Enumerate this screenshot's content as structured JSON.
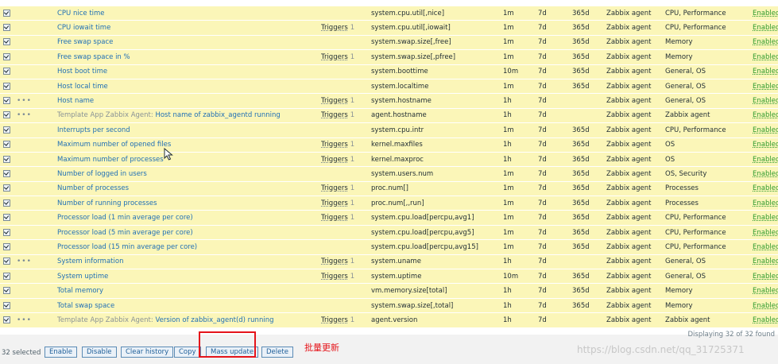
{
  "rows": [
    {
      "pre": "",
      "name": "CPU nice time",
      "triggers": "",
      "trig_count": "",
      "key": "system.cpu.util[,nice]",
      "interval": "1m",
      "history": "7d",
      "trends": "365d",
      "type": "Zabbix agent",
      "apps": "CPU, Performance",
      "status": "Enabled"
    },
    {
      "pre": "",
      "name": "CPU iowait time",
      "triggers": "Triggers",
      "trig_count": "1",
      "key": "system.cpu.util[,iowait]",
      "interval": "1m",
      "history": "7d",
      "trends": "365d",
      "type": "Zabbix agent",
      "apps": "CPU, Performance",
      "status": "Enabled"
    },
    {
      "pre": "",
      "name": "Free swap space",
      "triggers": "",
      "trig_count": "",
      "key": "system.swap.size[,free]",
      "interval": "1m",
      "history": "7d",
      "trends": "365d",
      "type": "Zabbix agent",
      "apps": "Memory",
      "status": "Enabled"
    },
    {
      "pre": "",
      "name": "Free swap space in %",
      "triggers": "Triggers",
      "trig_count": "1",
      "key": "system.swap.size[,pfree]",
      "interval": "1m",
      "history": "7d",
      "trends": "365d",
      "type": "Zabbix agent",
      "apps": "Memory",
      "status": "Enabled"
    },
    {
      "pre": "",
      "name": "Host boot time",
      "triggers": "",
      "trig_count": "",
      "key": "system.boottime",
      "interval": "10m",
      "history": "7d",
      "trends": "365d",
      "type": "Zabbix agent",
      "apps": "General, OS",
      "status": "Enabled"
    },
    {
      "pre": "",
      "name": "Host local time",
      "triggers": "",
      "trig_count": "",
      "key": "system.localtime",
      "interval": "1m",
      "history": "7d",
      "trends": "365d",
      "type": "Zabbix agent",
      "apps": "General, OS",
      "status": "Enabled"
    },
    {
      "pre": "",
      "name": "Host name",
      "triggers": "Triggers",
      "trig_count": "1",
      "key": "system.hostname",
      "interval": "1h",
      "history": "7d",
      "trends": "",
      "type": "Zabbix agent",
      "apps": "General, OS",
      "status": "Enabled",
      "dots": "•••"
    },
    {
      "pre": "Template App Zabbix Agent: ",
      "name": "Host name of zabbix_agentd running",
      "triggers": "Triggers",
      "trig_count": "1",
      "key": "agent.hostname",
      "interval": "1h",
      "history": "7d",
      "trends": "",
      "type": "Zabbix agent",
      "apps": "Zabbix agent",
      "status": "Enabled",
      "dots": "•••"
    },
    {
      "pre": "",
      "name": "Interrupts per second",
      "triggers": "",
      "trig_count": "",
      "key": "system.cpu.intr",
      "interval": "1m",
      "history": "7d",
      "trends": "365d",
      "type": "Zabbix agent",
      "apps": "CPU, Performance",
      "status": "Enabled"
    },
    {
      "pre": "",
      "name": "Maximum number of opened files",
      "triggers": "Triggers",
      "trig_count": "1",
      "key": "kernel.maxfiles",
      "interval": "1h",
      "history": "7d",
      "trends": "365d",
      "type": "Zabbix agent",
      "apps": "OS",
      "status": "Enabled"
    },
    {
      "pre": "",
      "name": "Maximum number of processes",
      "triggers": "Triggers",
      "trig_count": "1",
      "key": "kernel.maxproc",
      "interval": "1h",
      "history": "7d",
      "trends": "365d",
      "type": "Zabbix agent",
      "apps": "OS",
      "status": "Enabled"
    },
    {
      "pre": "",
      "name": "Number of logged in users",
      "triggers": "",
      "trig_count": "",
      "key": "system.users.num",
      "interval": "1m",
      "history": "7d",
      "trends": "365d",
      "type": "Zabbix agent",
      "apps": "OS, Security",
      "status": "Enabled"
    },
    {
      "pre": "",
      "name": "Number of processes",
      "triggers": "Triggers",
      "trig_count": "1",
      "key": "proc.num[]",
      "interval": "1m",
      "history": "7d",
      "trends": "365d",
      "type": "Zabbix agent",
      "apps": "Processes",
      "status": "Enabled"
    },
    {
      "pre": "",
      "name": "Number of running processes",
      "triggers": "Triggers",
      "trig_count": "1",
      "key": "proc.num[,,run]",
      "interval": "1m",
      "history": "7d",
      "trends": "365d",
      "type": "Zabbix agent",
      "apps": "Processes",
      "status": "Enabled"
    },
    {
      "pre": "",
      "name": "Processor load (1 min average per core)",
      "triggers": "Triggers",
      "trig_count": "1",
      "key": "system.cpu.load[percpu,avg1]",
      "interval": "1m",
      "history": "7d",
      "trends": "365d",
      "type": "Zabbix agent",
      "apps": "CPU, Performance",
      "status": "Enabled"
    },
    {
      "pre": "",
      "name": "Processor load (5 min average per core)",
      "triggers": "",
      "trig_count": "",
      "key": "system.cpu.load[percpu,avg5]",
      "interval": "1m",
      "history": "7d",
      "trends": "365d",
      "type": "Zabbix agent",
      "apps": "CPU, Performance",
      "status": "Enabled"
    },
    {
      "pre": "",
      "name": "Processor load (15 min average per core)",
      "triggers": "",
      "trig_count": "",
      "key": "system.cpu.load[percpu,avg15]",
      "interval": "1m",
      "history": "7d",
      "trends": "365d",
      "type": "Zabbix agent",
      "apps": "CPU, Performance",
      "status": "Enabled"
    },
    {
      "pre": "",
      "name": "System information",
      "triggers": "Triggers",
      "trig_count": "1",
      "key": "system.uname",
      "interval": "1h",
      "history": "7d",
      "trends": "",
      "type": "Zabbix agent",
      "apps": "General, OS",
      "status": "Enabled",
      "dots": "•••"
    },
    {
      "pre": "",
      "name": "System uptime",
      "triggers": "Triggers",
      "trig_count": "1",
      "key": "system.uptime",
      "interval": "10m",
      "history": "7d",
      "trends": "365d",
      "type": "Zabbix agent",
      "apps": "General, OS",
      "status": "Enabled"
    },
    {
      "pre": "",
      "name": "Total memory",
      "triggers": "",
      "trig_count": "",
      "key": "vm.memory.size[total]",
      "interval": "1h",
      "history": "7d",
      "trends": "365d",
      "type": "Zabbix agent",
      "apps": "Memory",
      "status": "Enabled"
    },
    {
      "pre": "",
      "name": "Total swap space",
      "triggers": "",
      "trig_count": "",
      "key": "system.swap.size[,total]",
      "interval": "1h",
      "history": "7d",
      "trends": "365d",
      "type": "Zabbix agent",
      "apps": "Memory",
      "status": "Enabled"
    },
    {
      "pre": "Template App Zabbix Agent: ",
      "name": "Version of zabbix_agent(d) running",
      "triggers": "Triggers",
      "trig_count": "1",
      "key": "agent.version",
      "interval": "1h",
      "history": "7d",
      "trends": "",
      "type": "Zabbix agent",
      "apps": "Zabbix agent",
      "status": "Enabled",
      "dots": "•••"
    }
  ],
  "footer": {
    "displaying": "Displaying 32 of 32 found",
    "selected": "32 selected",
    "buttons": {
      "enable": "Enable",
      "disable": "Disable",
      "clear_history": "Clear history",
      "copy": "Copy",
      "mass_update": "Mass update",
      "delete": "Delete"
    }
  },
  "annotation": "批量更新",
  "watermark": "https://blog.csdn.net/qq_31725371"
}
